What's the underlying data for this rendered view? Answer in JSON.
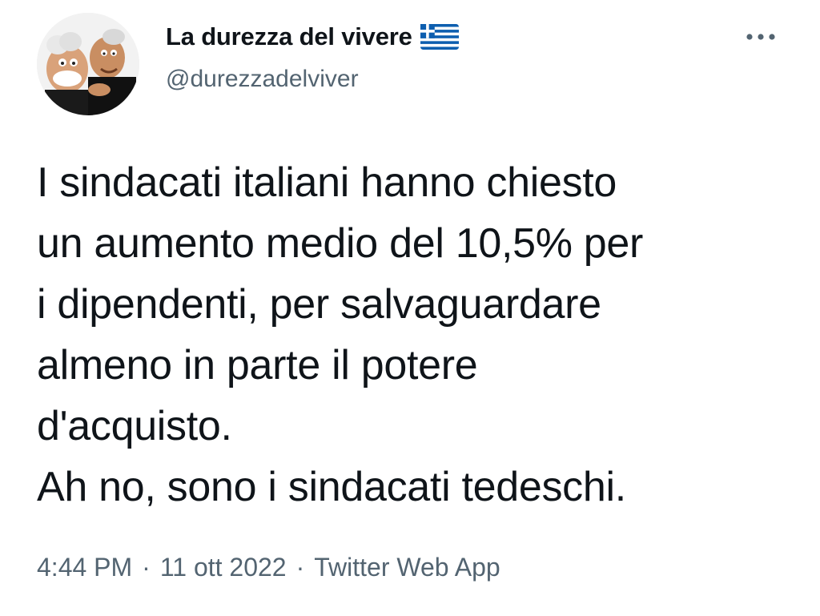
{
  "author": {
    "display_name": "La durezza del vivere",
    "handle": "@durezzadelviver",
    "flag_emoji": "greek-flag-icon"
  },
  "tweet": {
    "text": "I sindacati italiani hanno chiesto\nun aumento medio del 10,5% per\ni dipendenti, per salvaguardare\nalmeno in parte il potere\nd'acquisto.\nAh no, sono i sindacati tedeschi."
  },
  "meta": {
    "time": "4:44 PM",
    "separator": "·",
    "date": "11 ott 2022",
    "source": "Twitter Web App"
  },
  "colors": {
    "text": "#0f1419",
    "secondary": "#536471",
    "flag_blue": "#0d5eaf"
  }
}
